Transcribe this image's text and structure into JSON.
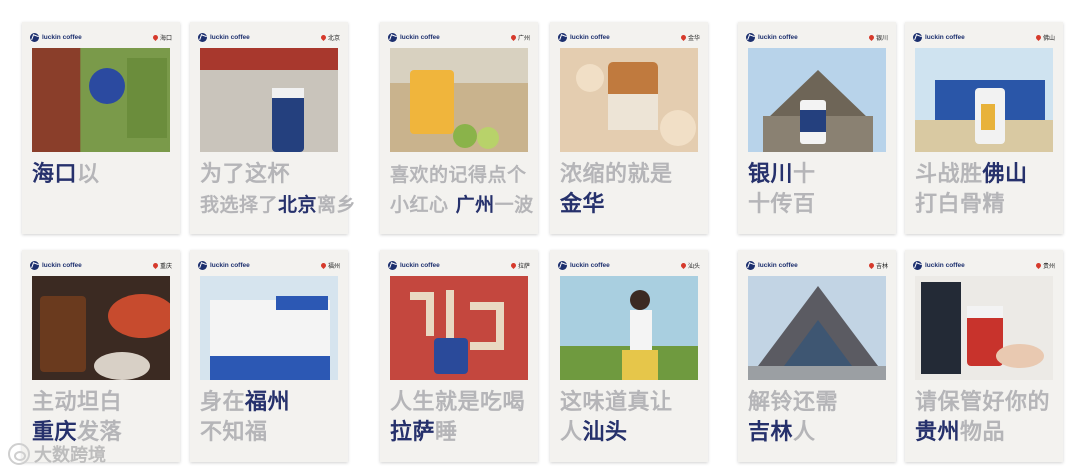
{
  "brand": "luckin coffee",
  "colors": {
    "highlight": "#26316c",
    "muted": "#b5b5b8",
    "pin": "#d63a2c"
  },
  "cards": [
    {
      "city": "海口",
      "lines": [
        [
          {
            "t": "海口",
            "h": true
          },
          {
            "t": "以",
            "h": false
          }
        ]
      ]
    },
    {
      "city": "北京",
      "lines": [
        [
          {
            "t": "为了这杯",
            "h": false
          }
        ],
        [
          {
            "t": "我选择了",
            "h": false
          },
          {
            "t": "北京",
            "h": true
          },
          {
            "t": "离乡",
            "h": false
          }
        ]
      ]
    },
    {
      "city": "广州",
      "lines": [
        [
          {
            "t": "喜欢的记得点个",
            "h": false
          }
        ],
        [
          {
            "t": "小红心 ",
            "h": false
          },
          {
            "t": "广州",
            "h": true
          },
          {
            "t": "一波",
            "h": false
          }
        ]
      ]
    },
    {
      "city": "金华",
      "lines": [
        [
          {
            "t": "浓缩的就是",
            "h": false
          }
        ],
        [
          {
            "t": "金华",
            "h": true
          }
        ]
      ]
    },
    {
      "city": "银川",
      "lines": [
        [
          {
            "t": "银川",
            "h": true
          },
          {
            "t": "十",
            "h": false
          }
        ],
        [
          {
            "t": "十传百",
            "h": false
          }
        ]
      ]
    },
    {
      "city": "佛山",
      "lines": [
        [
          {
            "t": "斗战胜",
            "h": false
          },
          {
            "t": "佛山",
            "h": true
          }
        ],
        [
          {
            "t": "打白骨精",
            "h": false
          }
        ]
      ]
    },
    {
      "city": "重庆",
      "lines": [
        [
          {
            "t": "主动坦白",
            "h": false
          }
        ],
        [
          {
            "t": "重庆",
            "h": true
          },
          {
            "t": "发落",
            "h": false
          }
        ]
      ]
    },
    {
      "city": "福州",
      "lines": [
        [
          {
            "t": "身在",
            "h": false
          },
          {
            "t": "福州",
            "h": true
          }
        ],
        [
          {
            "t": "不知福",
            "h": false
          }
        ]
      ]
    },
    {
      "city": "拉萨",
      "lines": [
        [
          {
            "t": "人生就是吃喝",
            "h": false
          }
        ],
        [
          {
            "t": "拉萨",
            "h": true
          },
          {
            "t": "睡",
            "h": false
          }
        ]
      ]
    },
    {
      "city": "汕头",
      "lines": [
        [
          {
            "t": "这味道真让",
            "h": false
          }
        ],
        [
          {
            "t": "人",
            "h": false
          },
          {
            "t": "汕头",
            "h": true
          }
        ]
      ]
    },
    {
      "city": "吉林",
      "lines": [
        [
          {
            "t": "解铃还需",
            "h": false
          }
        ],
        [
          {
            "t": "吉林",
            "h": true
          },
          {
            "t": "人",
            "h": false
          }
        ]
      ]
    },
    {
      "city": "贵州",
      "lines": [
        [
          {
            "t": "请保管好你的",
            "h": false
          }
        ],
        [
          {
            "t": "贵州",
            "h": true
          },
          {
            "t": "物品",
            "h": false
          }
        ]
      ]
    }
  ],
  "watermark": "大数跨境"
}
